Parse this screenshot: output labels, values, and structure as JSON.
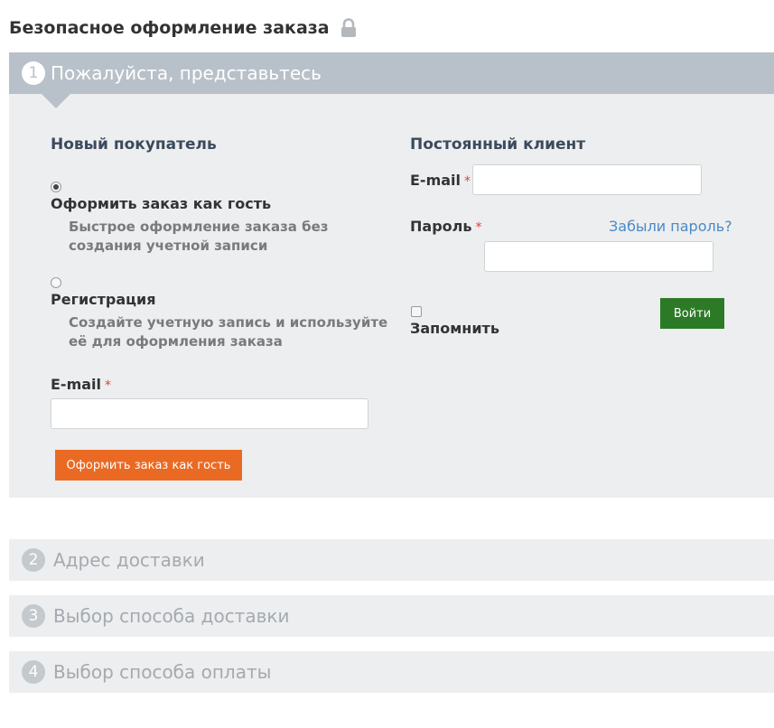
{
  "page": {
    "title": "Безопасное оформление заказа",
    "lock_icon": "lock-icon"
  },
  "step1": {
    "number": "1",
    "title": "Пожалуйста, представьтесь",
    "new_customer": {
      "title": "Новый покупатель",
      "guest_option": {
        "label": "Оформить заказ как гость",
        "description": "Быстрое оформление заказа без создания учетной записи",
        "checked": true
      },
      "register_option": {
        "label": "Регистрация",
        "description": "Создайте учетную запись и используйте её для оформления заказа",
        "checked": false
      },
      "email_label": "E-mail",
      "email_value": "",
      "required_mark": "*",
      "submit_label": "Оформить заказ как гость"
    },
    "returning_customer": {
      "title": "Постоянный клиент",
      "email_label": "E-mail",
      "email_value": "",
      "password_label": "Пароль",
      "password_value": "",
      "required_mark": "*",
      "forgot_label": "Забыли пароль?",
      "remember_label": "Запомнить",
      "login_label": "Войти"
    }
  },
  "steps": [
    {
      "number": "2",
      "title": "Адрес доставки"
    },
    {
      "number": "3",
      "title": "Выбор способа доставки"
    },
    {
      "number": "4",
      "title": "Выбор способа оплаты"
    }
  ],
  "colors": {
    "active_step_bg": "#b8c1c9",
    "panel_bg": "#edeeef",
    "guest_button": "#ea6a24",
    "login_button": "#2c7a26",
    "link": "#4a8ac7",
    "required": "#e04040"
  }
}
